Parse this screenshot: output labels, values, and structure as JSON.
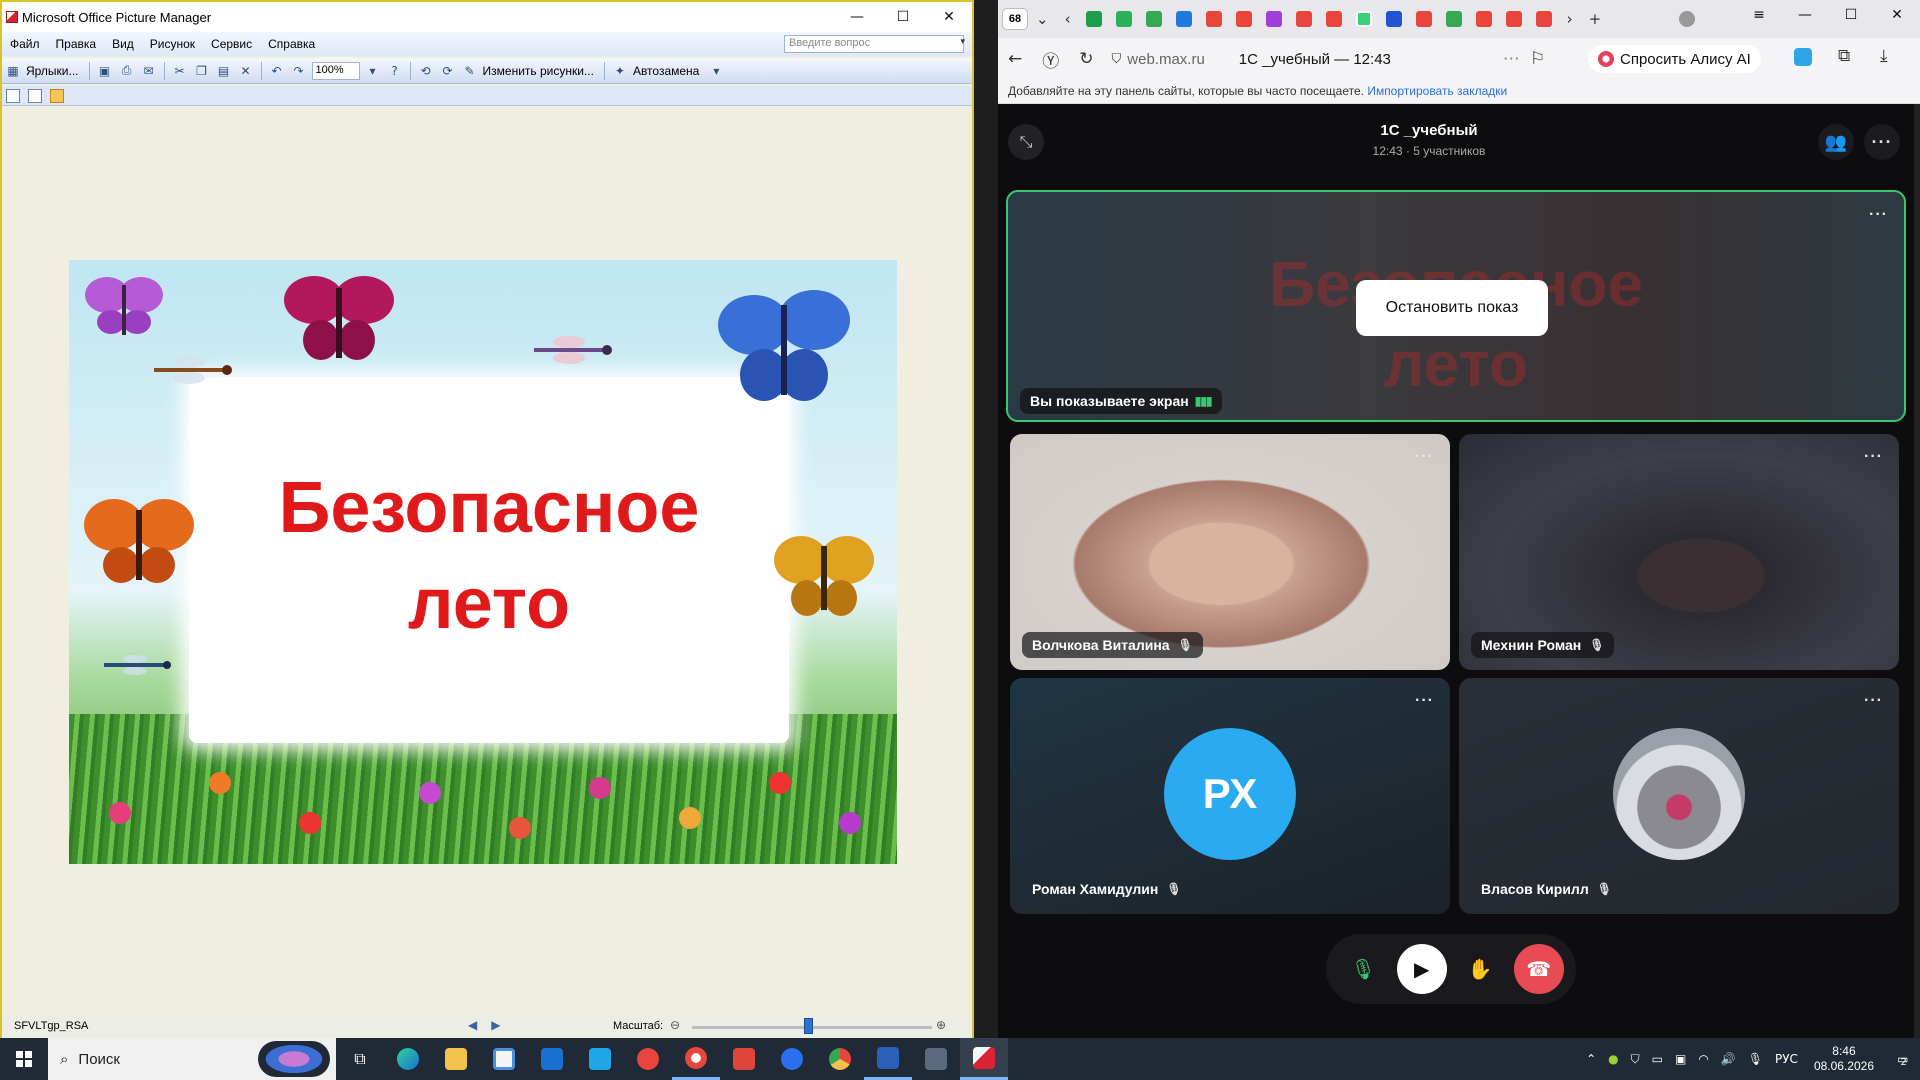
{
  "picture_manager": {
    "title": "Microsoft Office Picture Manager",
    "menu": [
      "Файл",
      "Правка",
      "Вид",
      "Рисунок",
      "Сервис",
      "Справка"
    ],
    "help_placeholder": "Введите вопрос",
    "toolbar": {
      "shortcuts_label": "Ярлыки...",
      "zoom_value": "100%",
      "edit_pictures_label": "Изменить рисунки...",
      "autocorrect_label": "Автозамена"
    },
    "picture": {
      "title": "Безопасное",
      "subtitle": "лето"
    },
    "status": {
      "filename": "SFVLTgp_RSA",
      "scale_label": "Масштаб:"
    }
  },
  "browser": {
    "tab_count": "68",
    "url": "web.max.ru",
    "page_title": "1С _учебный — 12:43",
    "alice_label": "Спросить Алису AI",
    "bookmarks_prompt": "Добавляйте на эту панель сайты, которые вы часто посещаете.",
    "import_link": "Импортировать закладки"
  },
  "call": {
    "title": "1С _учебный",
    "subtitle": "12:43 · 5 участников",
    "screen_share": {
      "stop_button": "Остановить показ",
      "label": "Вы показываете экран",
      "ghost_title": "Безопасное",
      "ghost_subtitle": "лето"
    },
    "participants": [
      {
        "name": "Волчкова Виталина"
      },
      {
        "name": "Мехнин Роман"
      },
      {
        "name": "Роман Хамидулин",
        "initials": "РХ"
      },
      {
        "name": "Власов Кирилл"
      }
    ]
  },
  "taskbar": {
    "search_label": "Поиск",
    "language": "РУС",
    "time": "8:46",
    "date": "08.06.2026",
    "notification_count": "2"
  }
}
